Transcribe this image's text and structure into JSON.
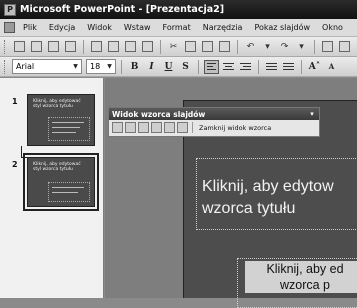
{
  "window": {
    "title": "Microsoft PowerPoint - [Prezentacja2]"
  },
  "menu": {
    "items": [
      "Plik",
      "Edycja",
      "Widok",
      "Wstaw",
      "Format",
      "Narzędzia",
      "Pokaz slajdów",
      "Okno"
    ]
  },
  "toolbar": {
    "font_name": "Arial",
    "font_size": "18",
    "bold_label": "B",
    "italic_label": "I",
    "underline_label": "U",
    "shadow_label": "S",
    "grow_font_label": "A˄",
    "shrink_font_label": "A"
  },
  "slides_panel": {
    "slides": [
      {
        "number": "1",
        "title": "Kliknij, aby edytować styl wzorca tytułu"
      },
      {
        "number": "2",
        "title": "Kliknij, aby edytować styl wzorca tytułu"
      }
    ]
  },
  "master_toolbar": {
    "title": "Widok wzorca slajdów",
    "close_label": "Zamknij widok wzorca"
  },
  "slide": {
    "title_text": "Kliknij, aby edytować styl wzorca tytułu",
    "title_line1": "Kliknij, aby edytow",
    "title_line2": "wzorca tytułu",
    "body_line1": "Kliknij, aby ed",
    "body_line2": "wzorca p"
  }
}
